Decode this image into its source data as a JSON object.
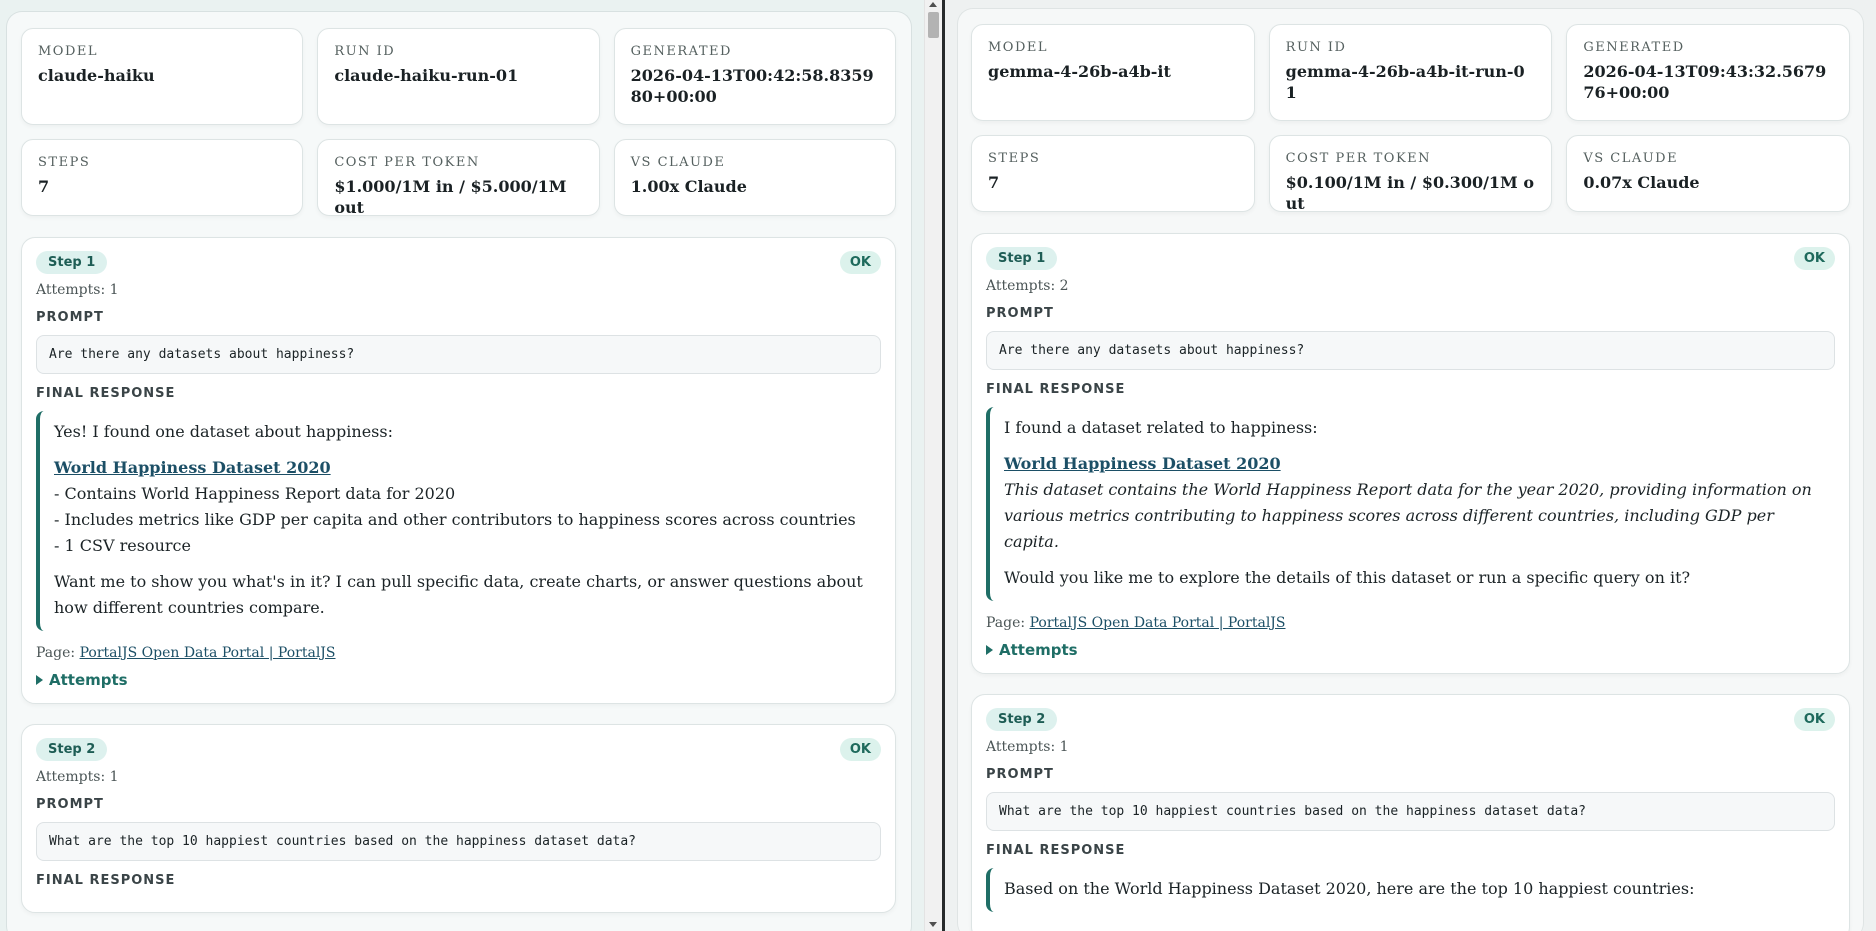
{
  "left": {
    "meta": {
      "model_label": "MODEL",
      "model": "claude-haiku",
      "run_label": "RUN ID",
      "run": "claude-haiku-run-01",
      "generated_label": "GENERATED",
      "generated": "2026-04-13T00:42:58.835980+00:00",
      "steps_label": "STEPS",
      "steps": "7",
      "cost_label": "COST PER TOKEN",
      "cost": "$1.000/1M in / $5.000/1M out",
      "vs_label": "VS CLAUDE",
      "vs": "1.00x Claude"
    },
    "step1": {
      "pill": "Step 1",
      "status": "OK",
      "attempts": "Attempts: 1",
      "prompt_label": "PROMPT",
      "prompt": "Are there any datasets about happiness?",
      "response_label": "FINAL RESPONSE",
      "r1": "Yes! I found one dataset about happiness:",
      "link": "World Happiness Dataset 2020",
      "b1": "- Contains World Happiness Report data for 2020",
      "b2": "- Includes metrics like GDP per capita and other contributors to happiness scores across countries",
      "b3": "- 1 CSV resource",
      "r2": "Want me to show you what's in it? I can pull specific data, create charts, or answer questions about how different countries compare.",
      "page_prefix": "Page:",
      "page_link": "PortalJS Open Data Portal | PortalJS",
      "attempts_toggle": "Attempts"
    },
    "step2": {
      "pill": "Step 2",
      "status": "OK",
      "attempts": "Attempts: 1",
      "prompt_label": "PROMPT",
      "prompt": "What are the top 10 happiest countries based on the happiness dataset data?",
      "response_label": "FINAL RESPONSE"
    }
  },
  "right": {
    "meta": {
      "model_label": "MODEL",
      "model": "gemma-4-26b-a4b-it",
      "run_label": "RUN ID",
      "run": "gemma-4-26b-a4b-it-run-01",
      "generated_label": "GENERATED",
      "generated": "2026-04-13T09:43:32.567976+00:00",
      "steps_label": "STEPS",
      "steps": "7",
      "cost_label": "COST PER TOKEN",
      "cost": "$0.100/1M in / $0.300/1M out",
      "vs_label": "VS CLAUDE",
      "vs": "0.07x Claude"
    },
    "step1": {
      "pill": "Step 1",
      "status": "OK",
      "attempts": "Attempts: 2",
      "prompt_label": "PROMPT",
      "prompt": "Are there any datasets about happiness?",
      "response_label": "FINAL RESPONSE",
      "r1": "I found a dataset related to happiness:",
      "link": "World Happiness Dataset 2020",
      "desc": "This dataset contains the World Happiness Report data for the year 2020, providing information on various metrics contributing to happiness scores across different countries, including GDP per capita.",
      "r2": "Would you like me to explore the details of this dataset or run a specific query on it?",
      "page_prefix": "Page:",
      "page_link": "PortalJS Open Data Portal | PortalJS",
      "attempts_toggle": "Attempts"
    },
    "step2": {
      "pill": "Step 2",
      "status": "OK",
      "attempts": "Attempts: 1",
      "prompt_label": "PROMPT",
      "prompt": "What are the top 10 happiest countries based on the happiness dataset data?",
      "response_label": "FINAL RESPONSE",
      "r1": "Based on the World Happiness Dataset 2020, here are the top 10 happiest countries:"
    }
  }
}
